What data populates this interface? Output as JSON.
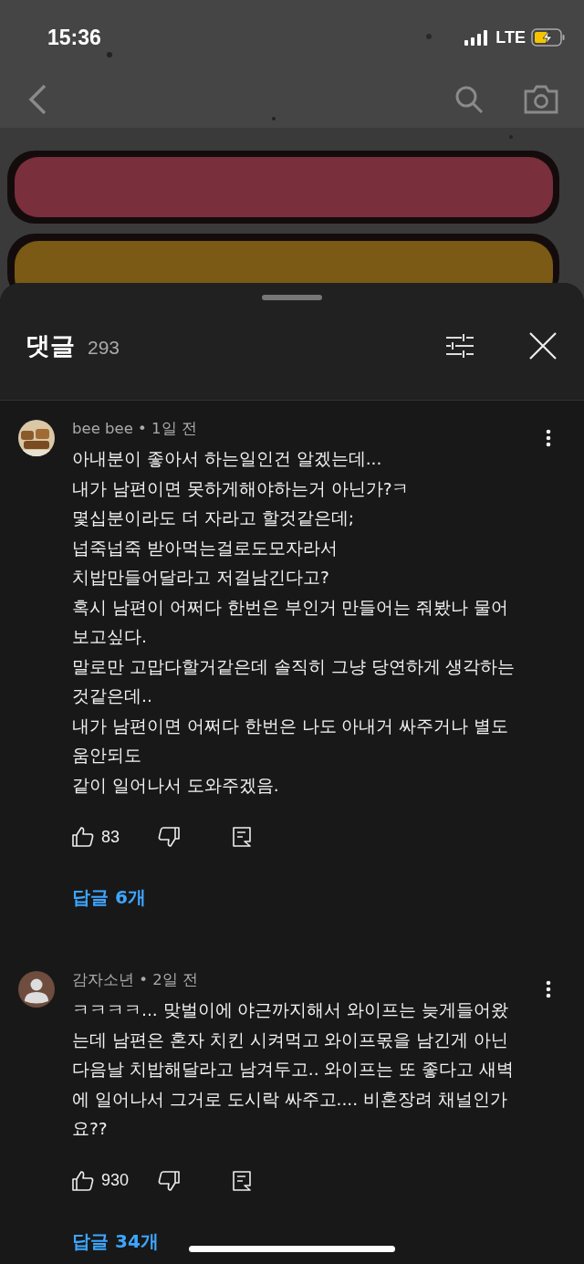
{
  "status_bar": {
    "time": "15:36",
    "network": "LTE"
  },
  "sheet": {
    "title": "댓글",
    "count": "293"
  },
  "comments": [
    {
      "byline": "bee bee • 1일 전",
      "lines": [
        "아내분이 좋아서 하는일인건 알겠는데...",
        "내가 남편이면 못하게해야하는거 아닌가?ㅋ",
        "몇십분이라도 더 자라고 할것같은데;",
        "넙죽넙죽 받아먹는걸로도모자라서",
        "치밥만들어달라고 저걸남긴다고?",
        "혹시 남편이 어쩌다 한번은 부인거 만들어는 줘봤나 물어",
        "보고싶다.",
        "말로만 고맙다할거같은데 솔직히 그냥 당연하게 생각하는",
        "것같은데..",
        "내가 남편이면 어쩌다 한번은 나도 아내거 싸주거나 별도",
        "움안되도",
        "같이 일어나서 도와주겠음."
      ],
      "likes": "83",
      "replies": "답글 6개"
    },
    {
      "byline": "감자소년 • 2일 전",
      "avatar": {
        "kind": "silhouette"
      },
      "lines": [
        "ㅋㅋㅋㅋ... 맞벌이에 야근까지해서 와이프는 늦게들어왔",
        "는데 남편은 혼자 치킨 시켜먹고 와이프몫을 남긴게 아닌",
        "다음날 치밥해달라고 남겨두고.. 와이프는 또 좋다고 새벽",
        "에 일어나서 그거로 도시락 싸주고.... 비혼장려 채널인가",
        "요??"
      ],
      "likes": "930",
      "replies": "답글 34개"
    }
  ]
}
